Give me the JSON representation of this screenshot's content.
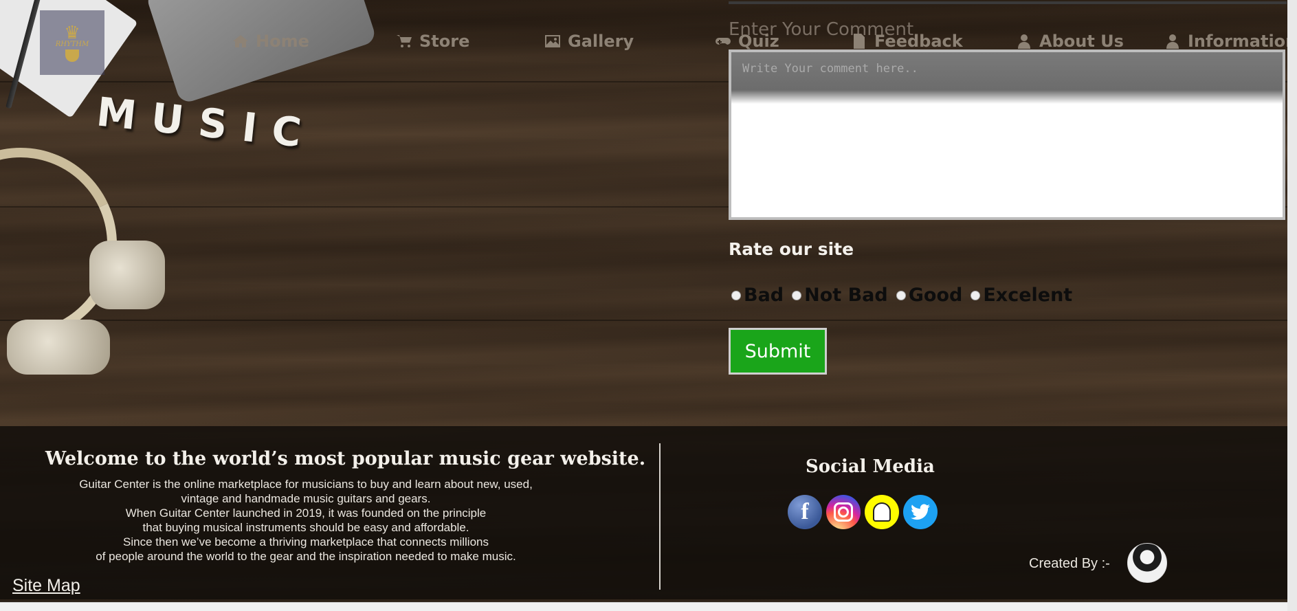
{
  "nav": {
    "logo_text": "RHYTHM",
    "items": [
      {
        "label": "Home",
        "icon": "home-icon"
      },
      {
        "label": "Store",
        "icon": "cart-icon"
      },
      {
        "label": "Gallery",
        "icon": "image-icon"
      },
      {
        "label": "Quiz",
        "icon": "gamepad-icon"
      },
      {
        "label": "Feedback",
        "icon": "document-icon"
      },
      {
        "label": "About Us",
        "icon": "user-icon"
      },
      {
        "label": "Information",
        "icon": "user-icon"
      }
    ]
  },
  "background": {
    "word": "MUSIC"
  },
  "feedback": {
    "comment_label": "Enter Your Comment",
    "comment_placeholder": "Write Your comment here..",
    "comment_value": "",
    "rate_title": "Rate our site",
    "ratings": [
      "Bad",
      "Not Bad",
      "Good",
      "Excelent"
    ],
    "submit_label": "Submit",
    "submit_color": "#1aa51a"
  },
  "footer": {
    "title": "Welcome to the world’s most popular music gear website.",
    "lines": [
      "Guitar Center is the online marketplace for musicians to buy and learn about new, used,",
      "vintage and handmade music guitars and gears.",
      "When Guitar Center launched in 2019, it was founded on the principle",
      "that buying musical instruments should be easy and affordable.",
      "Since then we’ve become a thriving marketplace that connects millions",
      "of people around the world to the gear and the inspiration needed to make music."
    ],
    "social_title": "Social Media",
    "social": [
      "facebook-icon",
      "instagram-icon",
      "snapchat-icon",
      "twitter-icon"
    ],
    "created_by": "Created By :-",
    "site_map": "Site Map"
  }
}
